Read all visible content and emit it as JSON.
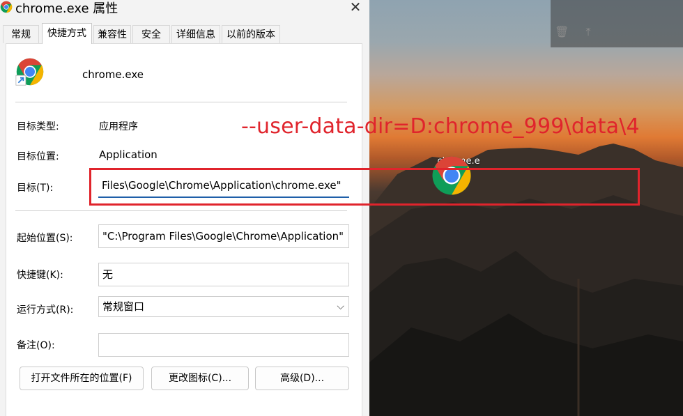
{
  "window": {
    "title": "chrome.exe 属性",
    "close_glyph": "✕"
  },
  "tabs": [
    {
      "label": "常规"
    },
    {
      "label": "快捷方式"
    },
    {
      "label": "兼容性"
    },
    {
      "label": "安全"
    },
    {
      "label": "详细信息"
    },
    {
      "label": "以前的版本"
    }
  ],
  "shortcut": {
    "file_name": "chrome.exe",
    "target_type_label": "目标类型:",
    "target_type_value": "应用程序",
    "target_location_label": "目标位置:",
    "target_location_value": "Application",
    "target_label": "目标(T):",
    "target_value": "Files\\Google\\Chrome\\Application\\chrome.exe\"",
    "start_in_label": "起始位置(S):",
    "start_in_value": "\"C:\\Program Files\\Google\\Chrome\\Application\"",
    "hotkey_label": "快捷键(K):",
    "hotkey_value": "无",
    "run_label": "运行方式(R):",
    "run_value": "常规窗口",
    "comment_label": "备注(O):",
    "comment_value": "",
    "buttons": {
      "open_location": "打开文件所在的位置(F)",
      "change_icon": "更改图标(C)...",
      "advanced": "高级(D)..."
    }
  },
  "annotation": {
    "text": "--user-data-dir=D:chrome_999\\data\\4",
    "color": "#e0242c"
  },
  "desktop": {
    "icon_label": "chrome.e",
    "panel_icons": [
      "trash-icon",
      "pin-icon"
    ]
  },
  "colors": {
    "chrome_red": "#db4437",
    "chrome_yellow": "#f4b400",
    "chrome_green": "#0f9d58",
    "chrome_blue": "#4285f4",
    "accent_underline": "#1f5fa9"
  }
}
